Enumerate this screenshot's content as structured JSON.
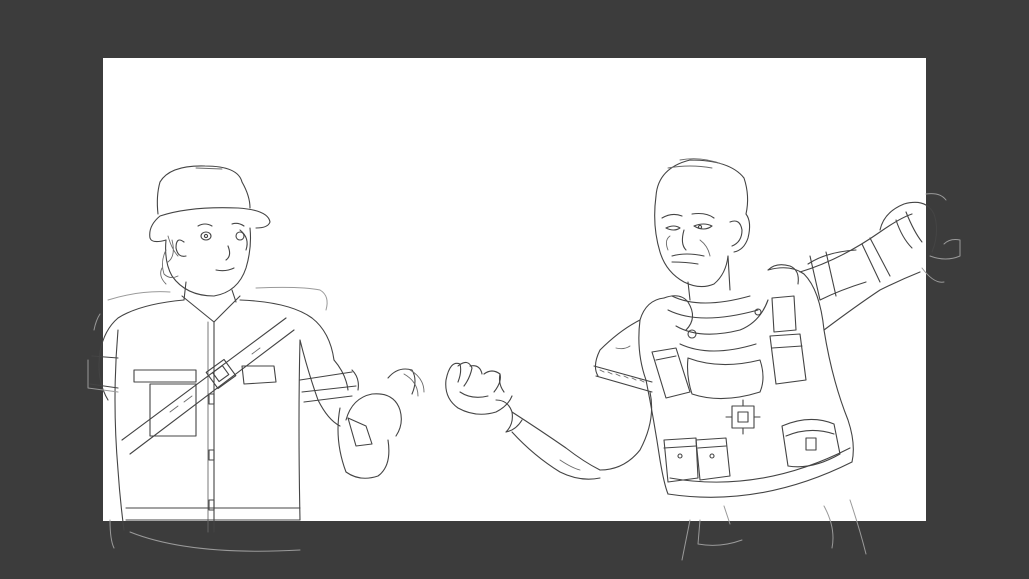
{
  "app": {
    "workspace_color": "#3c3c3c",
    "canvas_color": "#ffffff",
    "line_color": "#444444"
  },
  "artwork": {
    "type": "line-art sketch",
    "figures": [
      "figure-left-bucket-hat",
      "figure-right-tactical-vest"
    ]
  }
}
